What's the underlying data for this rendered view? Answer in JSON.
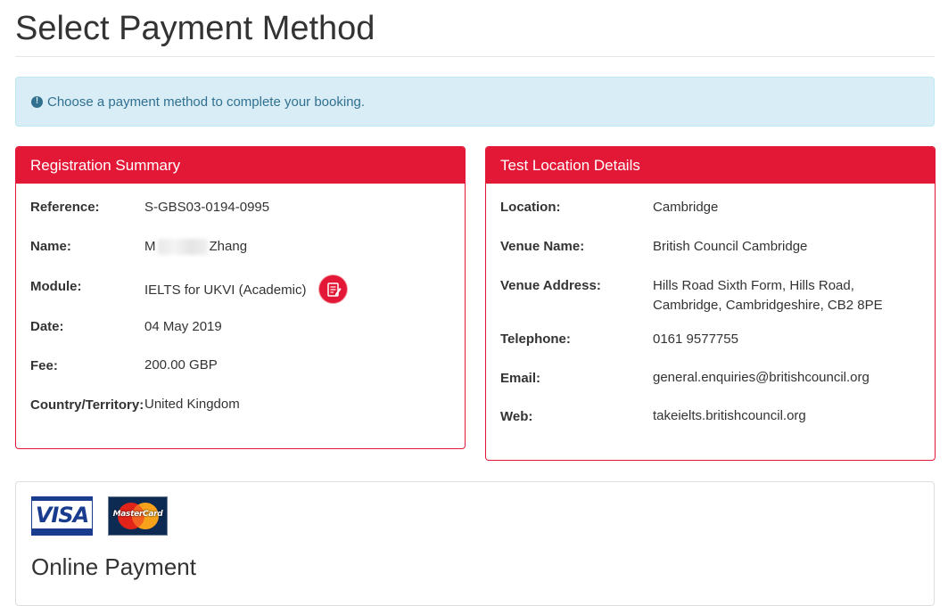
{
  "page": {
    "title": "Select Payment Method",
    "alert_text": "Choose a payment method to complete your booking.",
    "alert_icon": "info-circle-icon"
  },
  "colors": {
    "brand_red": "#e31837",
    "alert_bg": "#d9edf7",
    "alert_text": "#31708f"
  },
  "registration": {
    "heading": "Registration Summary",
    "rows": [
      {
        "label": "Reference:",
        "value": "S-GBS03-0194-0995"
      },
      {
        "label": "Name:",
        "value_start": "M",
        "value_end": "Zhang"
      },
      {
        "label": "Module:",
        "value": "IELTS for UKVI (Academic)"
      },
      {
        "label": "Date:",
        "value": "04 May 2019"
      },
      {
        "label": "Fee:",
        "value": "200.00 GBP"
      },
      {
        "label": "Country/Territory:",
        "value": "United Kingdom"
      }
    ]
  },
  "location": {
    "heading": "Test Location Details",
    "rows": [
      {
        "label": "Location:",
        "value": "Cambridge"
      },
      {
        "label": "Venue Name:",
        "value": "British Council Cambridge"
      },
      {
        "label": "Venue Address:",
        "value_line1": "Hills Road Sixth Form, Hills Road,",
        "value_line2": "Cambridge, Cambridgeshire, CB2 8PE"
      },
      {
        "label": "Telephone:",
        "value": "0161 9577755"
      },
      {
        "label": "Email:",
        "value": "general.enquiries@britishcouncil.org"
      },
      {
        "label": "Web:",
        "value": "takeielts.britishcouncil.org"
      }
    ]
  },
  "payment": {
    "visa_logo_text": "VISA",
    "mastercard_logo_text": "MasterCard",
    "section_title": "Online Payment"
  }
}
